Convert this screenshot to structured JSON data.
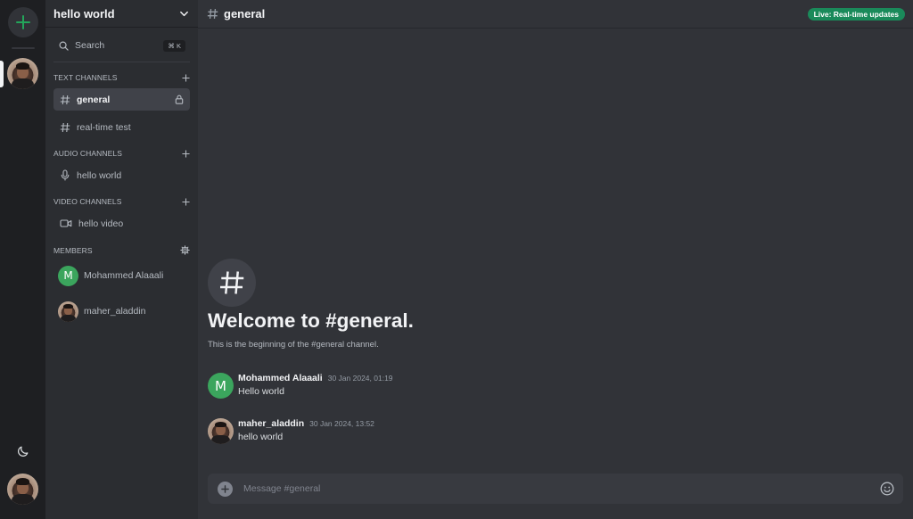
{
  "server": {
    "name": "hello world"
  },
  "search": {
    "label": "Search",
    "shortcut": "⌘ K"
  },
  "sections": {
    "text": "TEXT CHANNELS",
    "audio": "AUDIO CHANNELS",
    "video": "VIDEO CHANNELS",
    "members": "MEMBERS"
  },
  "text_channels": [
    {
      "name": "general",
      "active": true,
      "locked": true
    },
    {
      "name": "real-time test",
      "active": false,
      "locked": false
    }
  ],
  "audio_channels": [
    {
      "name": "hello world"
    }
  ],
  "video_channels": [
    {
      "name": "hello video"
    }
  ],
  "members": [
    {
      "name": "Mohammed Alaaali",
      "initial": "M",
      "avatar": "letter"
    },
    {
      "name": "maher_aladdin",
      "avatar": "photo"
    }
  ],
  "header": {
    "channel": "general",
    "live_badge": "Live: Real-time updates"
  },
  "welcome": {
    "title": "Welcome to #general.",
    "subtitle": "This is the beginning of the #general channel."
  },
  "messages": [
    {
      "author": "Mohammed Alaaali",
      "initial": "M",
      "time": "30 Jan 2024, 01:19",
      "text": "Hello world",
      "avatar": "letter"
    },
    {
      "author": "maher_aladdin",
      "time": "30 Jan 2024, 13:52",
      "text": "hello world",
      "avatar": "photo"
    }
  ],
  "composer": {
    "placeholder": "Message #general"
  },
  "colors": {
    "accent_green": "#23a55a",
    "letter_avatar": "#3ba55d",
    "live_badge": "#1a8a5a",
    "rail_bg": "#1e1f22",
    "sidebar_bg": "#2b2d31",
    "main_bg": "#313338"
  },
  "icons": {
    "add_server": "plus-icon",
    "theme": "moon-icon",
    "dropdown": "chevron-down-icon",
    "search": "search-icon",
    "text_channel": "hash-icon",
    "audio_channel": "mic-icon",
    "video_channel": "video-icon",
    "lock": "lock-icon",
    "members_settings": "gear-icon",
    "composer_add": "plus-circle-icon",
    "emoji": "smile-icon"
  }
}
